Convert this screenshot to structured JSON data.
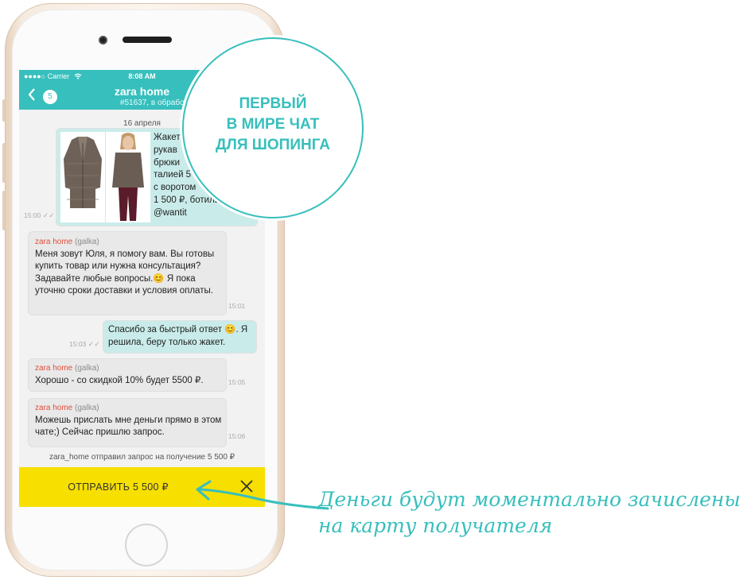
{
  "status_bar": {
    "carrier": "●●●●○ Carrier",
    "time": "8:08 AM"
  },
  "nav": {
    "back_count": "5",
    "title": "zara home",
    "subtitle": "#51637, в обработке"
  },
  "chat": {
    "date": "16 апреля",
    "photo_message": {
      "lines": [
        "Жакет",
        "рукав",
        "брюки",
        "талией 5",
        "с воротом",
        "1 500 ₽, ботиль",
        "@wantit"
      ],
      "time": "15:00"
    },
    "messages": [
      {
        "sender": "zara home",
        "nick": "(galka)",
        "text": "Меня зовут Юля, я помогу вам. Вы готовы купить товар или нужна консультация? Задавайте любые вопросы.😊 Я пока уточню сроки доставки и условия оплаты.",
        "time": "15:01"
      },
      {
        "outgoing": true,
        "text": "Спасибо за быстрый ответ 😊. Я решила, беру только жакет.",
        "time": "15:03"
      },
      {
        "sender": "zara home",
        "nick": "(galka)",
        "text": "Хорошо - со скидкой 10% будет 5500 ₽.",
        "time": "15:05"
      },
      {
        "sender": "zara home",
        "nick": "(galka)",
        "text": "Можешь прислать мне деньги прямо в этом чате;) Сейчас пришлю запрос.",
        "time": "15:06"
      }
    ],
    "system_note": "zara_home отправил запрос на получение 5 500 ₽"
  },
  "send_bar": {
    "label": "ОТПРАВИТЬ 5 500 ₽"
  },
  "promo": {
    "line1": "ПЕРВЫЙ",
    "line2": "В МИРЕ ЧАТ",
    "line3": "ДЛЯ ШОПИНГА"
  },
  "caption": {
    "line1": "Деньги будут моментально зачислены",
    "line2": "на карту получателя"
  },
  "colors": {
    "accent": "#37bfbd",
    "send_bar": "#f7df00",
    "sender": "#e04f3c"
  },
  "icons": {
    "back": "chevron-left-icon",
    "close": "close-icon",
    "wifi": "wifi-icon",
    "read": "double-check-icon"
  }
}
